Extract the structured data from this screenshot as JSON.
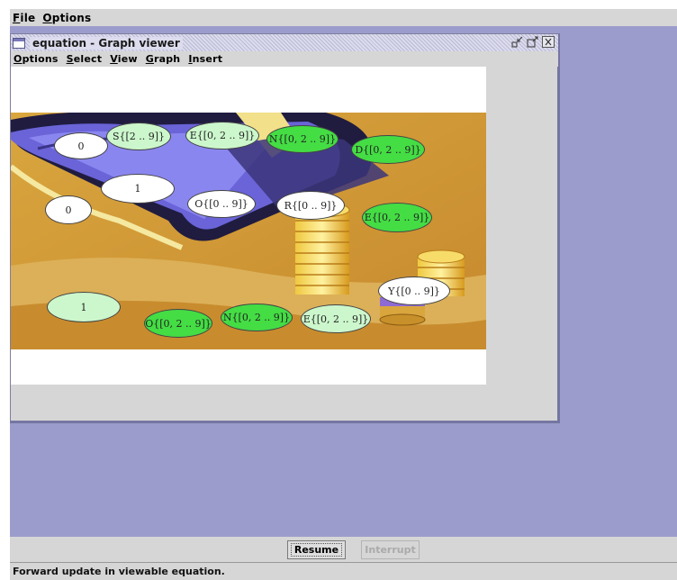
{
  "menubar": {
    "file": {
      "mnemonic": "F",
      "rest": "ile"
    },
    "options": {
      "mnemonic": "O",
      "rest": "ptions"
    }
  },
  "window": {
    "title": "equation - Graph viewer",
    "icon": "window-icon",
    "buttons": [
      "iconify-icon",
      "maximize-icon",
      "close-icon"
    ],
    "menu": [
      {
        "mnemonic": "O",
        "rest": "ptions"
      },
      {
        "mnemonic": "S",
        "rest": "elect"
      },
      {
        "mnemonic": "V",
        "rest": "iew"
      },
      {
        "mnemonic": "G",
        "rest": "raph"
      },
      {
        "mnemonic": "I",
        "rest": "nsert"
      }
    ]
  },
  "graph": {
    "nodes": [
      {
        "label": "0",
        "fill": "white"
      },
      {
        "label": "S{[2 .. 9]}",
        "fill": "pale"
      },
      {
        "label": "E{[0, 2 .. 9]}",
        "fill": "pale"
      },
      {
        "label": "N{[0, 2 .. 9]}",
        "fill": "bright"
      },
      {
        "label": "D{[0, 2 .. 9]}",
        "fill": "bright"
      },
      {
        "label": "1",
        "fill": "white"
      },
      {
        "label": "0",
        "fill": "white"
      },
      {
        "label": "O{[0 .. 9]}",
        "fill": "white"
      },
      {
        "label": "R{[0 .. 9]}",
        "fill": "white"
      },
      {
        "label": "E{[0, 2 .. 9]}",
        "fill": "bright"
      },
      {
        "label": "Y{[0 .. 9]}",
        "fill": "white"
      },
      {
        "label": "1",
        "fill": "pale"
      },
      {
        "label": "O{[0, 2 .. 9]}",
        "fill": "bright"
      },
      {
        "label": "N{[0, 2 .. 9]}",
        "fill": "bright"
      },
      {
        "label": "E{[0, 2 .. 9]}",
        "fill": "pale"
      }
    ]
  },
  "buttons": {
    "resume": "Resume",
    "interrupt": "Interrupt",
    "interrupt_enabled": false
  },
  "status": "Forward update in viewable equation.",
  "colors": {
    "desktop": "#9c9ccc",
    "panel": "#d6d6d6",
    "node_bright": "#44dd44",
    "node_pale": "#ccf7cc"
  }
}
